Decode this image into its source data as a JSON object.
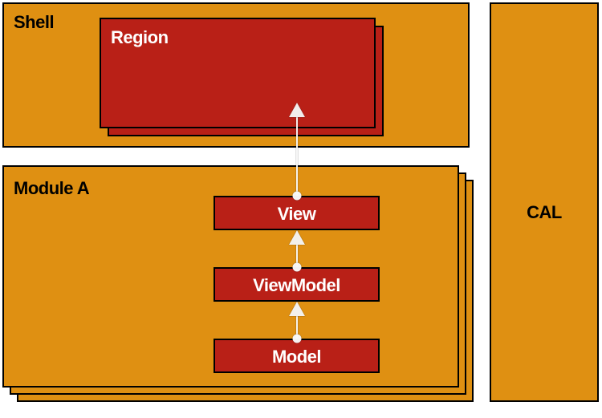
{
  "shell": {
    "label": "Shell",
    "region_label": "Region"
  },
  "module": {
    "label": "Module A",
    "view_label": "View",
    "viewmodel_label": "ViewModel",
    "model_label": "Model"
  },
  "cal": {
    "label": "CAL"
  },
  "colors": {
    "orange": "#df9012",
    "red": "#b92017",
    "black": "#000000",
    "white": "#ffffff"
  }
}
